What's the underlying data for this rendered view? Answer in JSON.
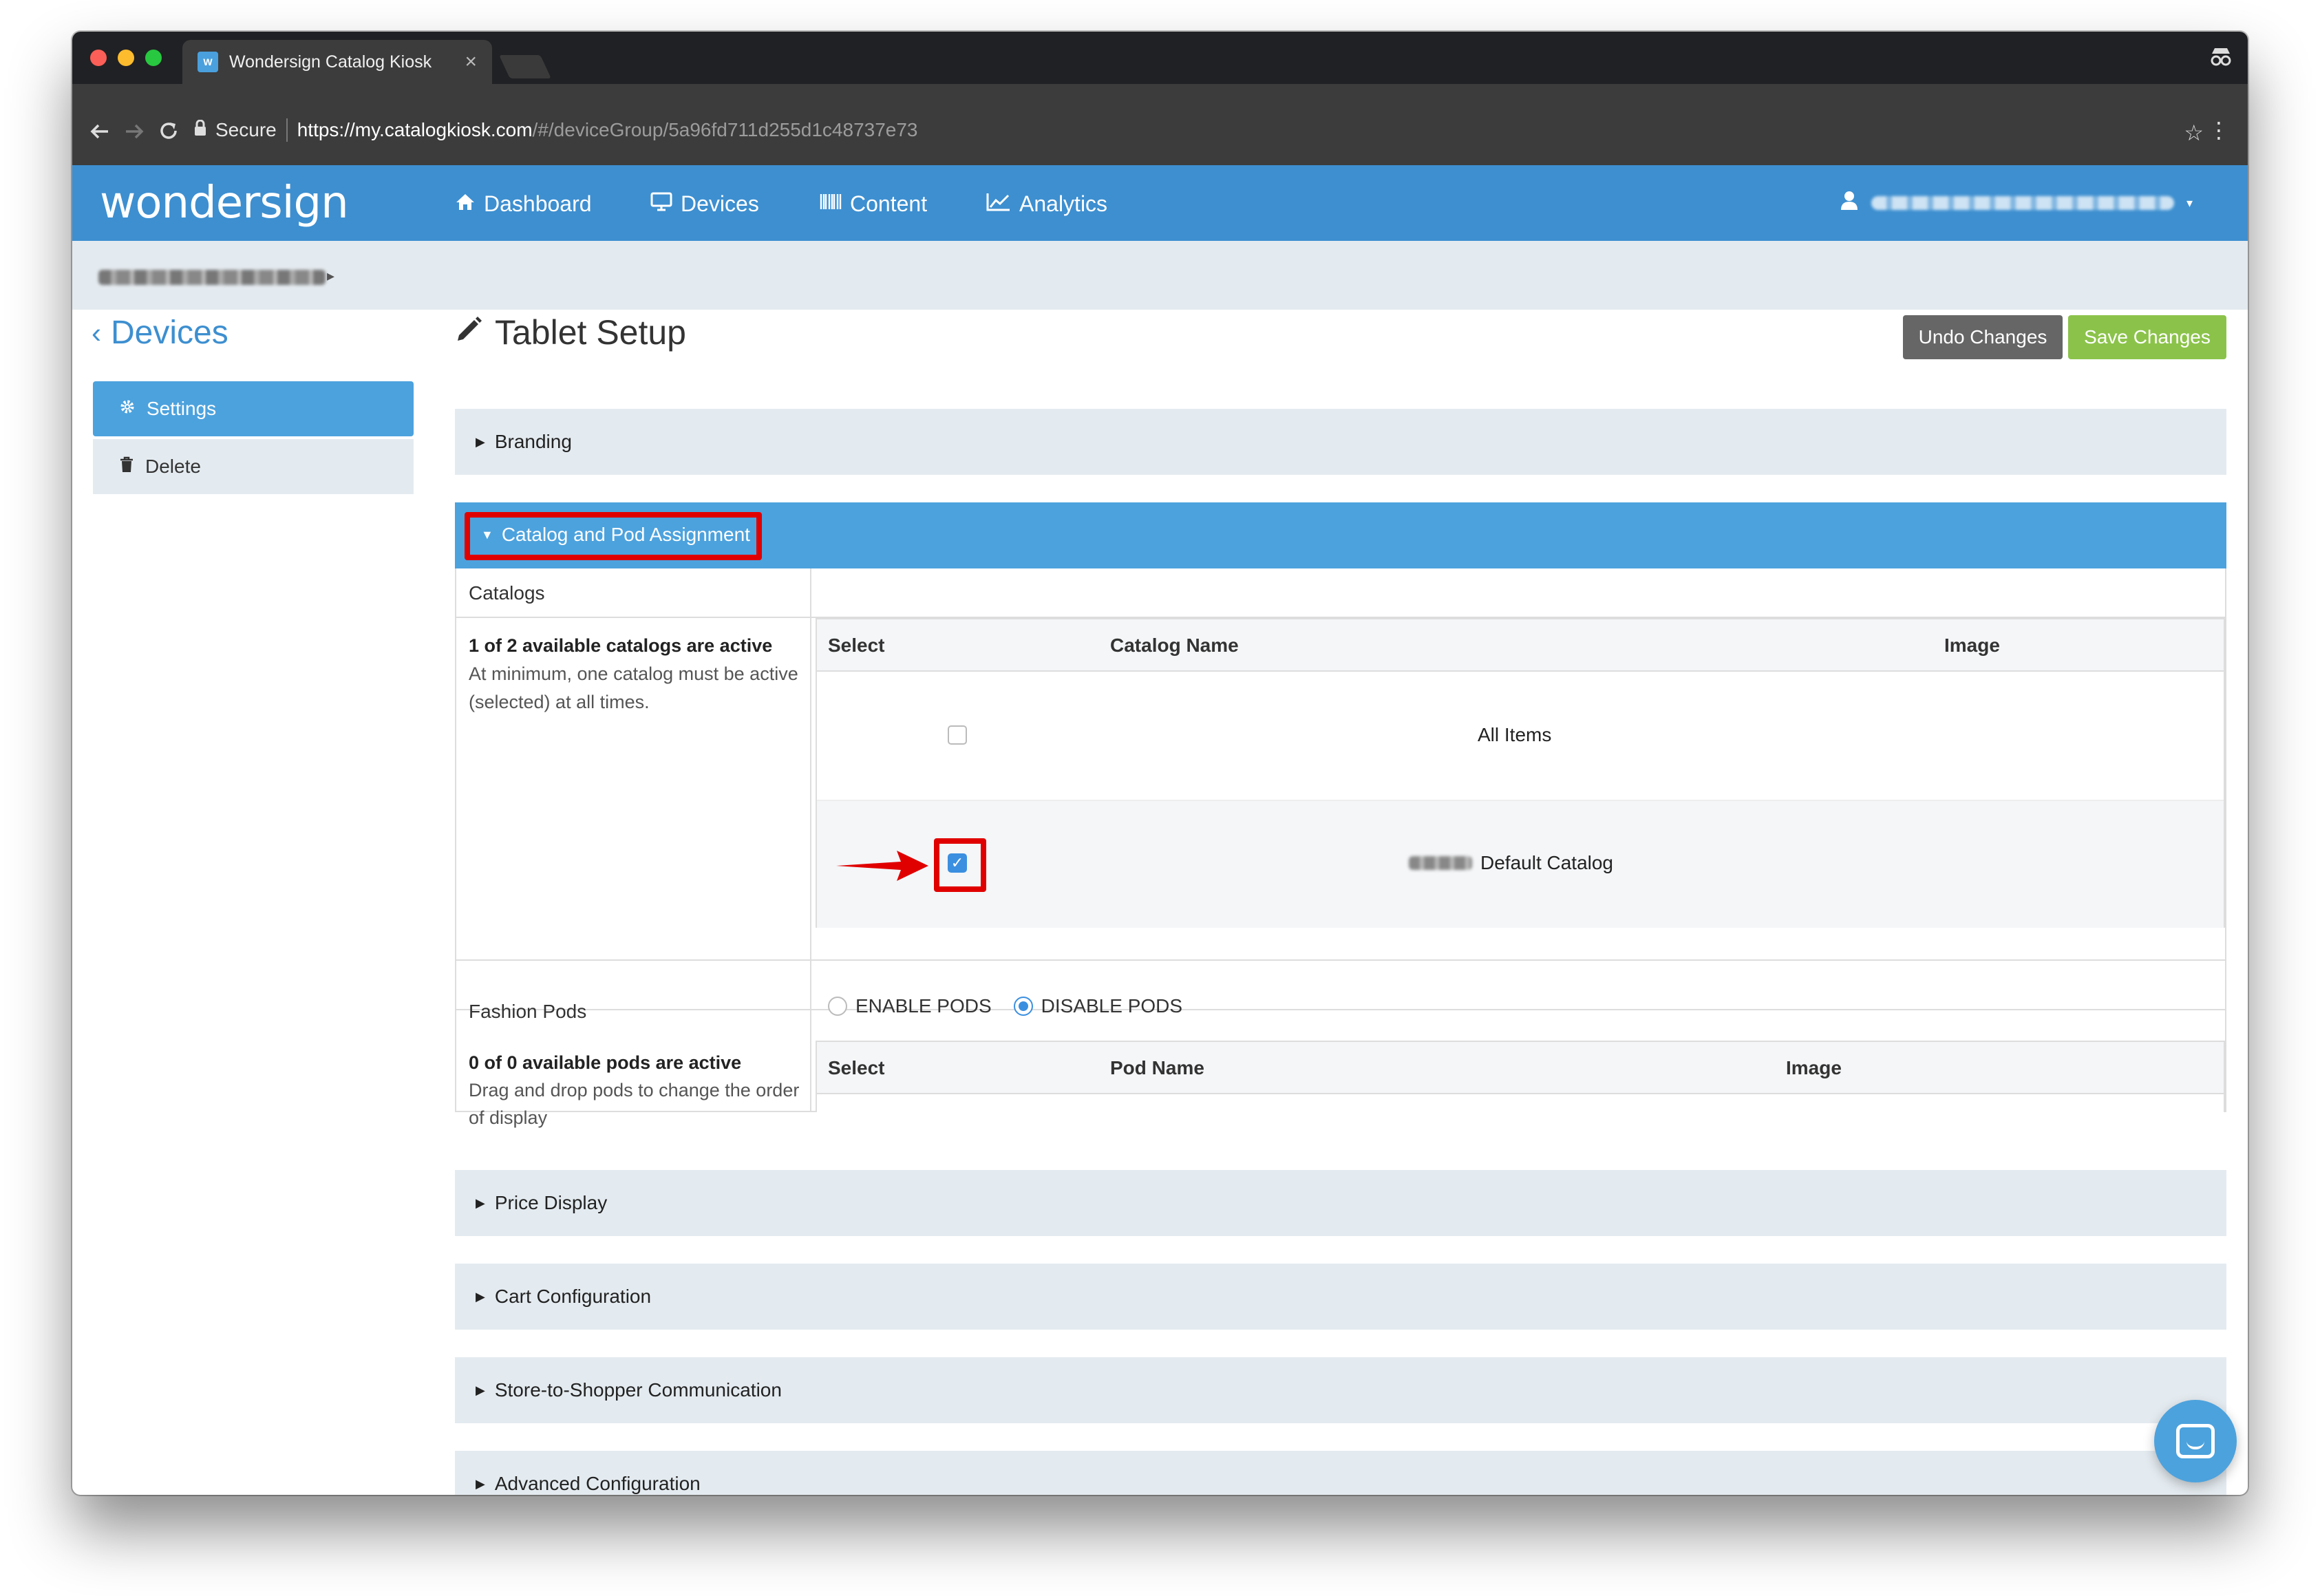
{
  "browser": {
    "tab_title": "Wondersign Catalog Kiosk",
    "tab_favicon": "W",
    "close_glyph": "×",
    "secure_label": "Secure",
    "url_host": "https://my.catalogkiosk.com",
    "url_path": "/#/deviceGroup/5a96fd711d255d1c48737e73"
  },
  "app": {
    "logo": "wondersign",
    "nav": [
      {
        "label": "Dashboard",
        "icon": "home-icon"
      },
      {
        "label": "Devices",
        "icon": "monitor-icon"
      },
      {
        "label": "Content",
        "icon": "barcode-icon"
      },
      {
        "label": "Analytics",
        "icon": "chart-icon"
      }
    ]
  },
  "sidebar": {
    "back_label": "Devices",
    "items": [
      {
        "label": "Settings",
        "icon": "gear-icon"
      },
      {
        "label": "Delete",
        "icon": "trash-icon"
      }
    ]
  },
  "header": {
    "title": "Tablet Setup",
    "undo_label": "Undo Changes",
    "save_label": "Save Changes"
  },
  "panels": {
    "branding": "Branding",
    "catalog": "Catalog and Pod Assignment",
    "price": "Price Display",
    "cart": "Cart Configuration",
    "store": "Store-to-Shopper Communication",
    "advanced": "Advanced Configuration"
  },
  "catalogs": {
    "label": "Catalogs",
    "summary_bold": "1 of 2 available catalogs are active",
    "summary_text": "At minimum, one catalog must be active (selected) at all times.",
    "columns": [
      "Select",
      "Catalog Name",
      "Image"
    ],
    "rows": [
      {
        "name": "All Items",
        "selected": false
      },
      {
        "name": "Default Catalog",
        "selected": true
      }
    ],
    "check_glyph": "✓"
  },
  "pods": {
    "label": "Fashion Pods",
    "enable_label": "ENABLE PODS",
    "disable_label": "DISABLE PODS",
    "mode": "disable",
    "summary_bold": "0 of 0 available pods are active",
    "summary_text": "Drag and drop pods to change the order of display",
    "columns": [
      "Select",
      "Pod Name",
      "Image"
    ]
  },
  "colors": {
    "primary": "#3d8fd0",
    "panel_active": "#4ca2dd",
    "save_green": "#8bc34a",
    "undo_gray": "#666666",
    "highlight_red": "#e00000"
  }
}
